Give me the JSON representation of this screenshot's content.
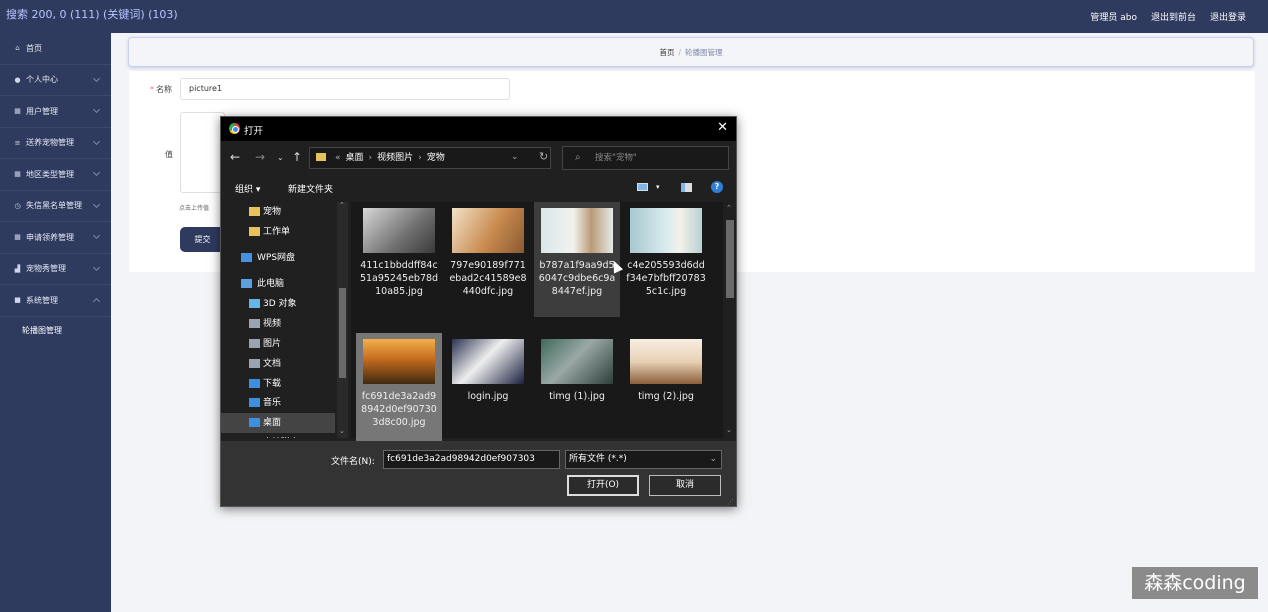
{
  "overlay_title": "搜索 200, 0 (111) (关键词) (103)",
  "header": {
    "admin": "管理员 abo",
    "exit_front": "退出到前台",
    "logout": "退出登录"
  },
  "sidebar": {
    "items": [
      {
        "label": "首页",
        "icon": "home-icon",
        "chevron": false
      },
      {
        "label": "个人中心",
        "icon": "person-icon",
        "chevron": true
      },
      {
        "label": "用户管理",
        "icon": "grid-icon",
        "chevron": true
      },
      {
        "label": "送养宠物管理",
        "icon": "list-icon",
        "chevron": true
      },
      {
        "label": "地区类型管理",
        "icon": "grid-icon",
        "chevron": true
      },
      {
        "label": "失信黑名单管理",
        "icon": "clock-icon",
        "chevron": true
      },
      {
        "label": "申请领养管理",
        "icon": "grid-icon",
        "chevron": true
      },
      {
        "label": "宠物秀管理",
        "icon": "chart-icon",
        "chevron": true
      },
      {
        "label": "系统管理",
        "icon": "apps-icon",
        "chevron": true
      }
    ],
    "sub_item": "轮播图管理"
  },
  "breadcrumb": {
    "home": "首页",
    "current": "轮播图管理"
  },
  "form": {
    "name_label": "名称",
    "name_value": "picture1",
    "value_label": "值",
    "upload_hint": "点击上传值",
    "submit": "提交"
  },
  "dialog": {
    "title": "打开",
    "path": [
      "桌面",
      "视频图片",
      "宠物"
    ],
    "search_placeholder": "搜索\"宠物\"",
    "organize": "组织",
    "new_folder": "新建文件夹",
    "nav_items": [
      {
        "label": "宠物",
        "icon": "folder-icon",
        "indent": 2
      },
      {
        "label": "工作单",
        "icon": "folder-icon",
        "indent": 2
      },
      {
        "label": "WPS网盘",
        "icon": "cloud-icon",
        "indent": 1
      },
      {
        "label": "此电脑",
        "icon": "computer-icon",
        "indent": 1
      },
      {
        "label": "3D 对象",
        "icon": "cube-icon",
        "indent": 2
      },
      {
        "label": "视频",
        "icon": "video-icon",
        "indent": 2
      },
      {
        "label": "图片",
        "icon": "picture-icon",
        "indent": 2
      },
      {
        "label": "文档",
        "icon": "document-icon",
        "indent": 2
      },
      {
        "label": "下载",
        "icon": "download-icon",
        "indent": 2
      },
      {
        "label": "音乐",
        "icon": "music-icon",
        "indent": 2
      },
      {
        "label": "桌面",
        "icon": "desktop-icon",
        "indent": 2,
        "selected": true
      },
      {
        "label": "本地磁盘 (C:)",
        "icon": "disk-icon",
        "indent": 2
      }
    ],
    "files": [
      {
        "name": "411c1bbddff84c51a95245eb78d10a85.jpg",
        "thumb": "gray-cat"
      },
      {
        "name": "797e90189f771ebad2c41589e8440dfc.jpg",
        "thumb": "orange-cat"
      },
      {
        "name": "b787a1f9aa9d56047c9dbe6c9a8447ef.jpg",
        "thumb": "kitten-bowl",
        "state": "hover"
      },
      {
        "name": "c4e205593d6ddf34e7bfbff207835c1c.jpg",
        "thumb": "white-kitten"
      },
      {
        "name": "fc691de3a2ad98942d0ef907303d8c00.jpg",
        "thumb": "forest",
        "state": "selected"
      },
      {
        "name": "login.jpg",
        "thumb": "kitten-night"
      },
      {
        "name": "timg (1).jpg",
        "thumb": "fluffy-cat"
      },
      {
        "name": "timg (2).jpg",
        "thumb": "kittens-basket"
      }
    ],
    "filename_label": "文件名(N):",
    "filename_value": "fc691de3a2ad98942d0ef907303",
    "filter": "所有文件 (*.*)",
    "open": "打开(O)",
    "cancel": "取消"
  },
  "watermark": "森森coding"
}
